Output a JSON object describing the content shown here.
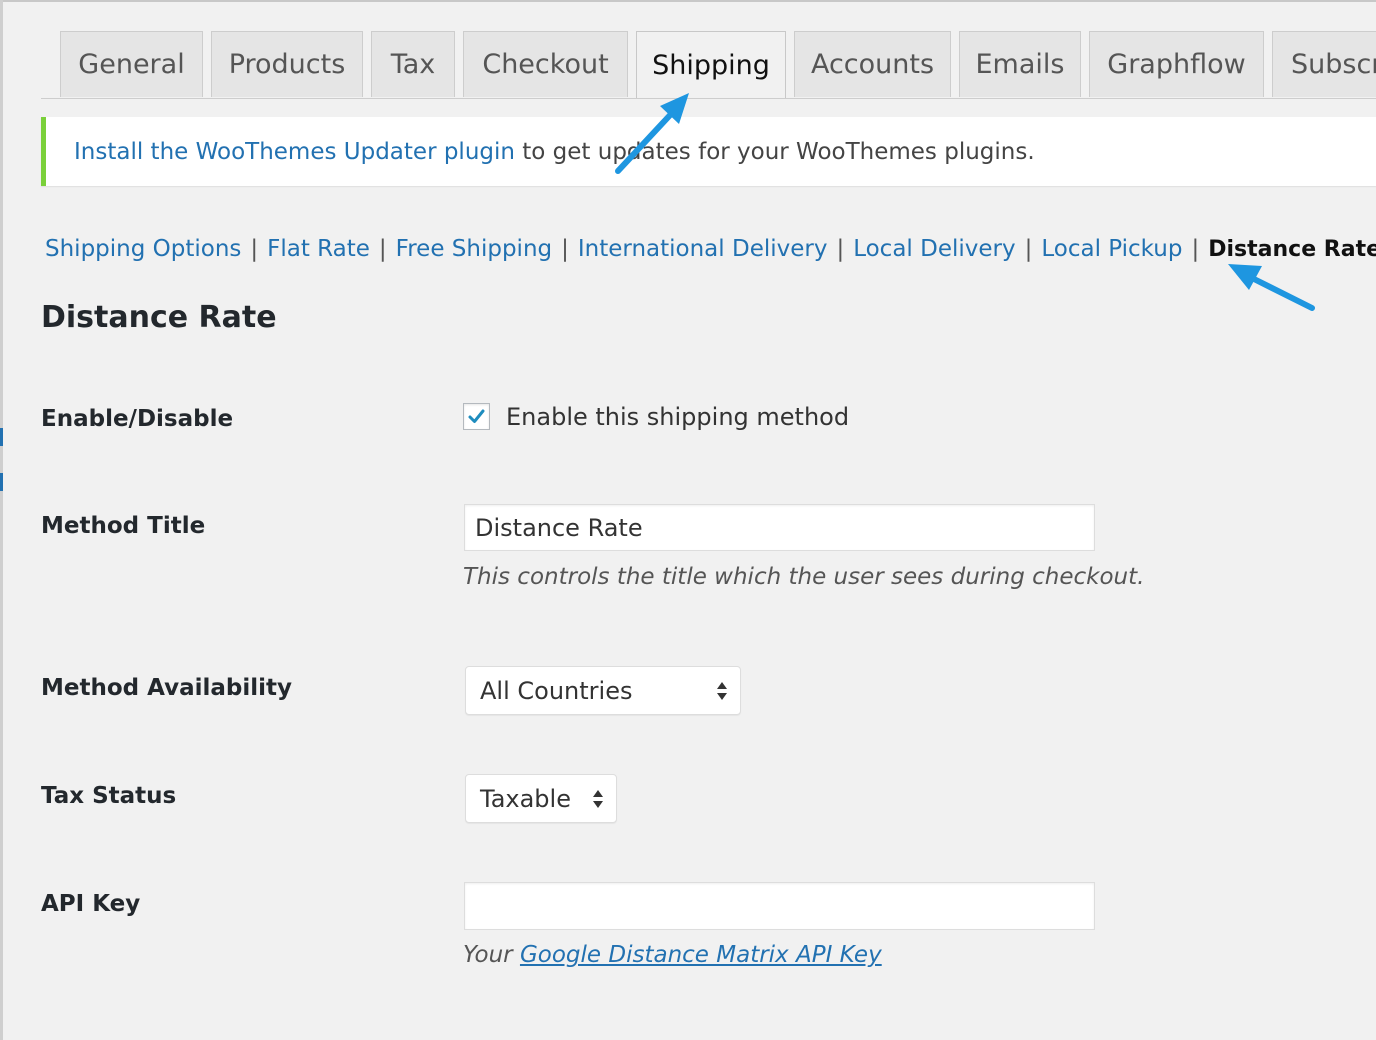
{
  "tabs": [
    {
      "label": "General",
      "active": false
    },
    {
      "label": "Products",
      "active": false
    },
    {
      "label": "Tax",
      "active": false
    },
    {
      "label": "Checkout",
      "active": false
    },
    {
      "label": "Shipping",
      "active": true
    },
    {
      "label": "Accounts",
      "active": false
    },
    {
      "label": "Emails",
      "active": false
    },
    {
      "label": "Graphflow",
      "active": false
    },
    {
      "label": "Subscr",
      "active": false
    }
  ],
  "notice": {
    "link_text": "Install the WooThemes Updater plugin",
    "text": " to get updates for your WooThemes plugins."
  },
  "subnav": {
    "items": [
      "Shipping Options",
      "Flat Rate",
      "Free Shipping",
      "International Delivery",
      "Local Delivery",
      "Local Pickup"
    ],
    "current": "Distance Rate",
    "separator": "|"
  },
  "page_title": "Distance Rate",
  "fields": {
    "enable": {
      "label": "Enable/Disable",
      "checkbox_label": "Enable this shipping method",
      "checked": true
    },
    "method_title": {
      "label": "Method Title",
      "value": "Distance Rate",
      "description": "This controls the title which the user sees during checkout."
    },
    "availability": {
      "label": "Method Availability",
      "selected": "All Countries"
    },
    "tax_status": {
      "label": "Tax Status",
      "selected": "Taxable"
    },
    "api_key": {
      "label": "API Key",
      "value": "",
      "description_prefix": "Your ",
      "description_link": "Google Distance Matrix API Key"
    }
  },
  "colors": {
    "link": "#2271b1",
    "notice_border": "#7ad03a",
    "annotation_arrow": "#1e96e0",
    "background": "#f1f1f1"
  },
  "annotations": [
    "arrow-to-shipping-tab",
    "arrow-to-distance-rate-link"
  ]
}
